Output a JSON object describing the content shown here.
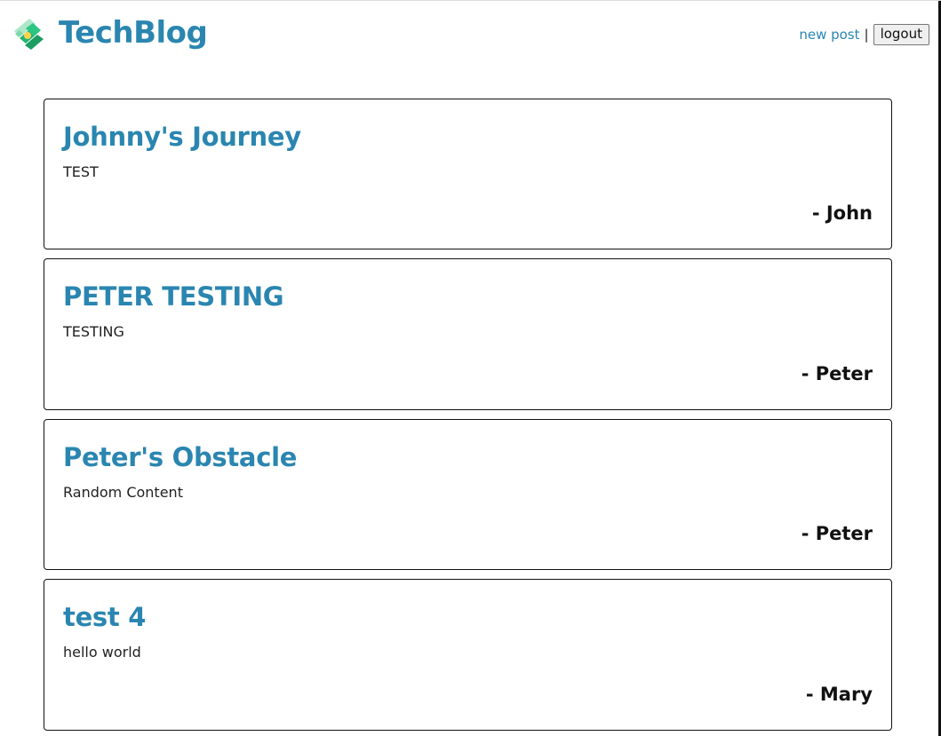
{
  "header": {
    "brand": "TechBlog",
    "logo_icon": "money-bill-icon",
    "nav": {
      "new_post": "new post",
      "separator": "|",
      "logout": "logout"
    }
  },
  "colors": {
    "accent": "#2a86b0",
    "text": "#222222",
    "border": "#111111"
  },
  "posts": [
    {
      "title": "Johnny's Journey",
      "body": "TEST",
      "author": "- John"
    },
    {
      "title": "PETER TESTING",
      "body": "TESTING",
      "author": "- Peter"
    },
    {
      "title": "Peter's Obstacle",
      "body": "Random Content",
      "author": "- Peter"
    },
    {
      "title": "test 4",
      "body": "hello world",
      "author": "- Mary"
    }
  ]
}
